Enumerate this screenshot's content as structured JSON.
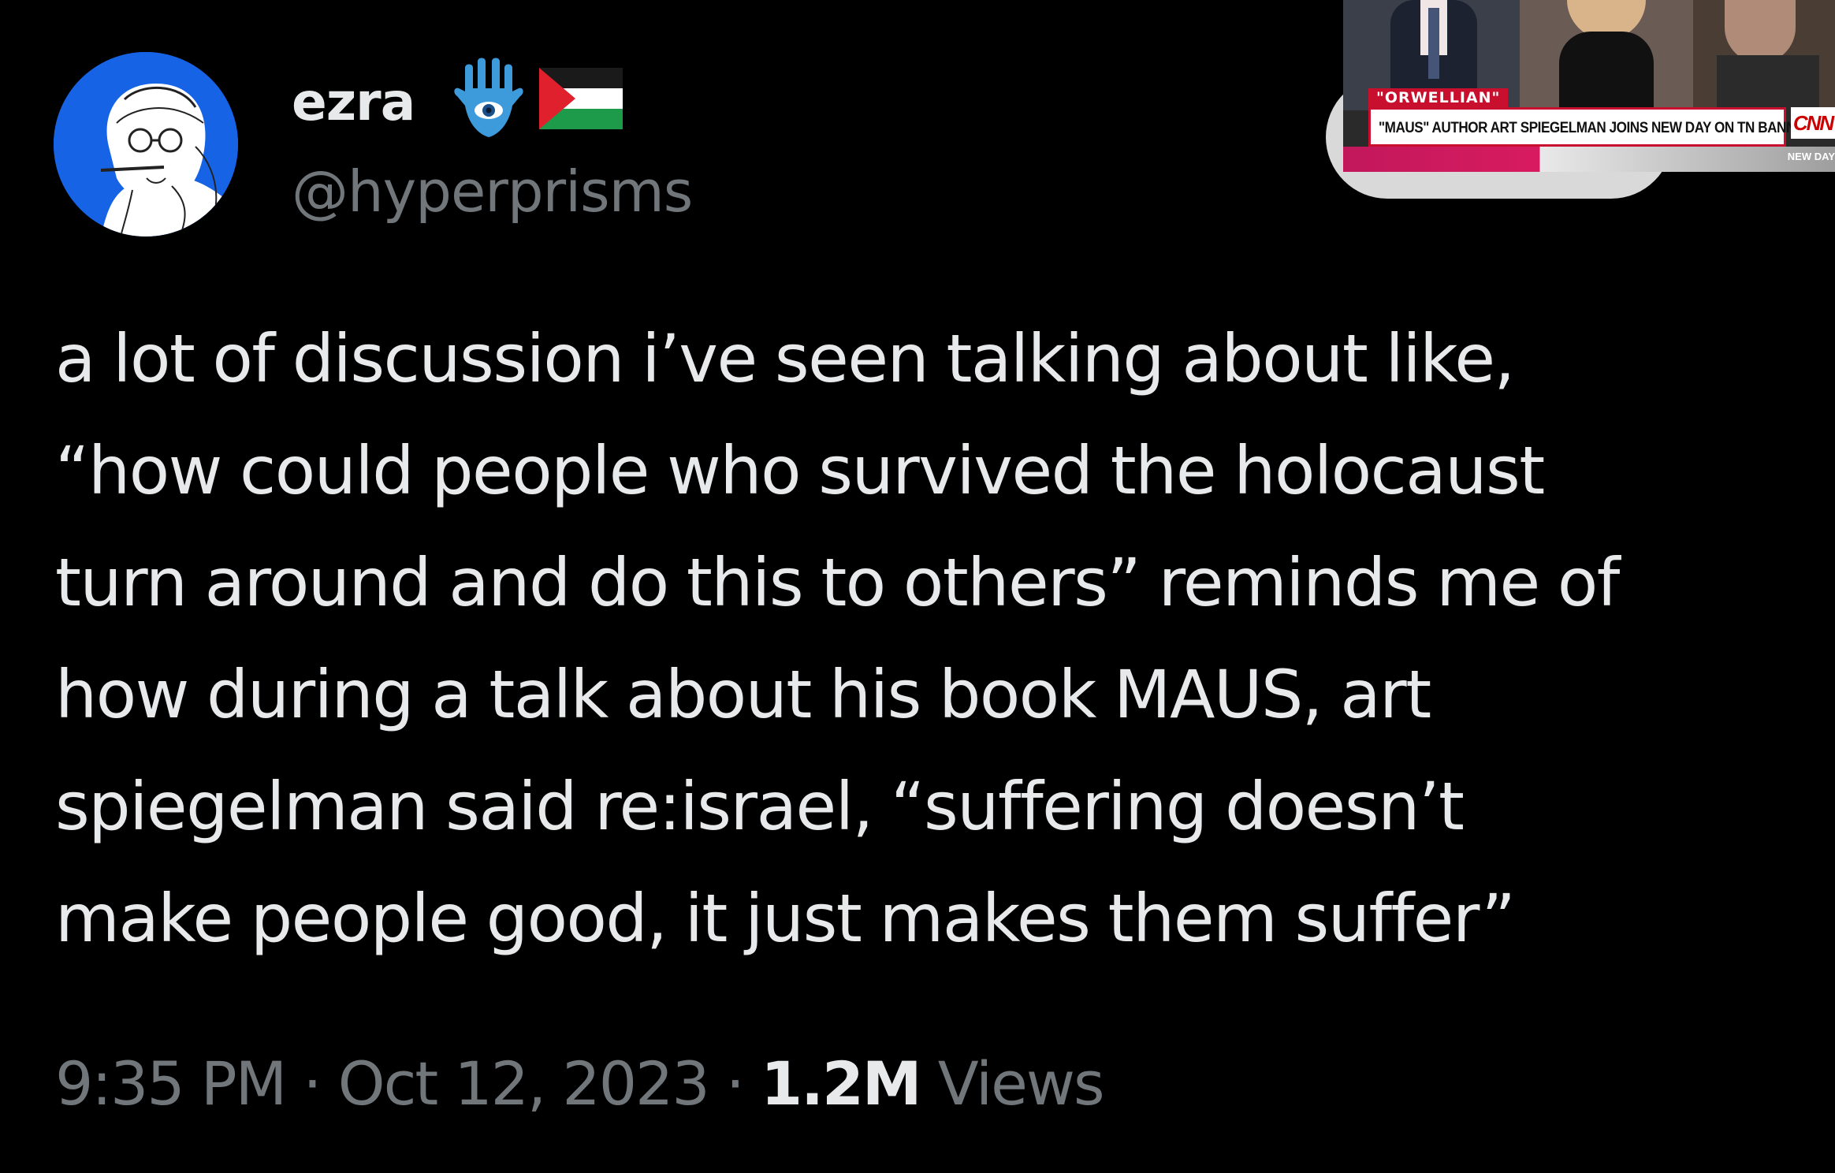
{
  "tweet": {
    "author": {
      "display_name": "ezra",
      "handle": "@hyperprisms",
      "badges": [
        "hamsa-icon",
        "palestine-flag-icon"
      ]
    },
    "text_lines": [
      "a lot of discussion i’ve seen talking about like,",
      "“how could people who survived the holocaust",
      "turn around and do this to others” reminds me of",
      "how during a talk about his book MAUS, art",
      "spiegelman said re:israel, “suffering doesn’t",
      "make people good, it just makes them suffer”"
    ],
    "time": "9:35 PM",
    "separator": "·",
    "date": "Oct 12, 2023",
    "views_count": "1.2M",
    "views_label": "Views"
  },
  "news_inset": {
    "tag": "\"ORWELLIAN\"",
    "headline": "\"MAUS\" AUTHOR ART SPIEGELMAN JOINS NEW DAY ON TN BANNING BOOK",
    "network_logo": "CNN",
    "show_name": "NEW DAY"
  },
  "colors": {
    "background": "#000000",
    "primary_text": "#e7e9ea",
    "secondary_text": "#71767b",
    "avatar_blue": "#1763e6",
    "cnn_red": "#cc0000"
  }
}
